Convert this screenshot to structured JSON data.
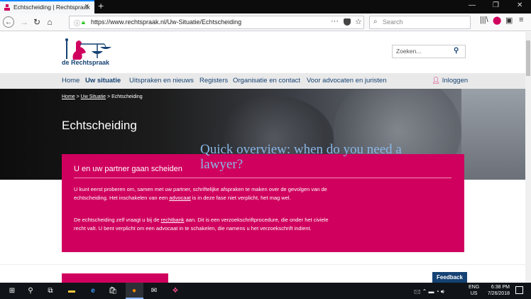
{
  "browser": {
    "tab_title": "Echtscheiding | Rechtspraak",
    "new_tab_symbol": "+",
    "url": "https://www.rechtspraak.nl/Uw-Situatie/Echtscheiding",
    "search_placeholder": "Search"
  },
  "site": {
    "logo_text": "de Rechtspraak",
    "search_placeholder": "Zoeken...",
    "nav": [
      "Home",
      "Uw situatie",
      "Uitspraken en nieuws",
      "Registers",
      "Organisatie en contact",
      "Voor advocaten en juristen"
    ],
    "login_label": "Inloggen",
    "breadcrumb": {
      "home": "Home",
      "sep1": " > ",
      "section": "Uw Situatie",
      "sep2": " > ",
      "current": "Echtscheiding"
    },
    "page_title": "Echtscheiding",
    "overlay_text": "Quick overview: when do you need a lawyer?",
    "card": {
      "title": "U en uw partner gaan scheiden",
      "p1_a": "U kunt eerst proberen om, samen met uw partner, schriftelijke afspraken te maken over de gevolgen van de echtscheiding. Het inschakelen van een ",
      "p1_link": "advocaat",
      "p1_b": " is in deze fase niet verplicht, het mag wel.",
      "p2_a": "De echtscheiding zelf vraagt u bij de ",
      "p2_link": "rechtbank",
      "p2_b": " aan. Dit is een verzoekschriftprocedure, die onder het civiele recht valt. U bent verplicht om een advocaat in te schakelen, die namens u het verzoekschrift indient."
    },
    "feedback_label": "Feedback"
  },
  "taskbar": {
    "lang_line1": "ENG",
    "lang_line2": "US",
    "time": "6:38 PM",
    "date": "7/26/2018"
  },
  "colors": {
    "brand_pink": "#d0005e",
    "brand_blue": "#154273",
    "overlay_text": "#8ab8e8"
  }
}
